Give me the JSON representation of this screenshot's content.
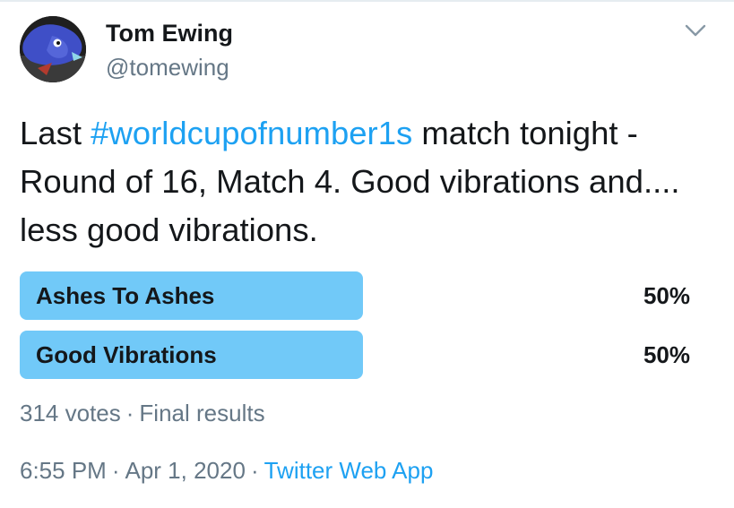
{
  "author": {
    "display_name": "Tom Ewing",
    "handle": "@tomewing",
    "avatar_icon": "avatar-image"
  },
  "menu_icon": "chevron-down-icon",
  "tweet": {
    "text_before": "Last ",
    "hashtag": "#worldcupofnumber1s",
    "text_after": " match tonight - Round of 16, Match 4. Good vibrations and.... less good vibrations."
  },
  "poll": {
    "options": [
      {
        "label": "Ashes To Ashes",
        "percent_text": "50%",
        "percent": 50
      },
      {
        "label": "Good Vibrations",
        "percent_text": "50%",
        "percent": 50
      }
    ],
    "votes": "314 votes",
    "separator": "·",
    "status": "Final results"
  },
  "meta": {
    "time": "6:55 PM",
    "date": "Apr 1, 2020",
    "separator": "·",
    "source": "Twitter Web App"
  },
  "colors": {
    "bar": "#71c9f8",
    "link": "#1da1f2",
    "muted": "#657786",
    "text": "#14171a"
  }
}
